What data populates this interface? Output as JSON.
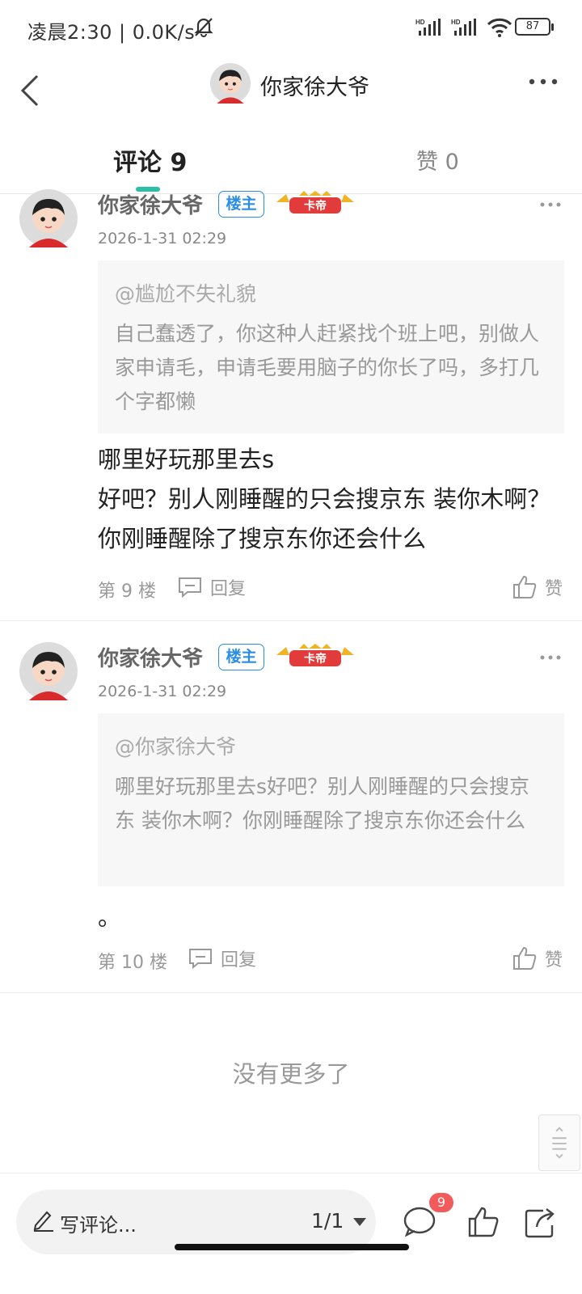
{
  "status_bar": {
    "text": "凌晨2:30 | 0.0K/s",
    "battery": "87"
  },
  "header": {
    "title": "你家徐大爷"
  },
  "tabs": {
    "comments": "评论 9",
    "likes": "赞 0"
  },
  "comments": [
    {
      "author": "你家徐大爷",
      "owner_badge": "楼主",
      "card_badge": "卡帝",
      "time": "2026-1-31 02:29",
      "quote_author": "@尴尬不失礼貌",
      "quote_text": "自己蠢透了，你这种人赶紧找个班上吧，别做人家申请毛，申请毛要用脑子的你长了吗，多打几个字都懒",
      "body": "哪里好玩那里去s\n好吧？别人刚睡醒的只会搜京东 装你木啊？你刚睡醒除了搜京东你还会什么",
      "floor": "第 9 楼",
      "reply": "回复",
      "like": "赞"
    },
    {
      "author": "你家徐大爷",
      "owner_badge": "楼主",
      "card_badge": "卡帝",
      "time": "2026-1-31 02:29",
      "quote_author": "@你家徐大爷",
      "quote_text": "哪里好玩那里去s好吧？别人刚睡醒的只会搜京东 装你木啊？你刚睡醒除了搜京东你还会什么",
      "body": "。",
      "floor": "第 10 楼",
      "reply": "回复",
      "like": "赞"
    }
  ],
  "footer": {
    "no_more": "没有更多了"
  },
  "bottom_bar": {
    "placeholder": "写评论...",
    "page": "1/1",
    "comment_count": "9"
  },
  "colors": {
    "accent": "#2dbfa6",
    "owner_badge": "#2b8de8",
    "badge_red": "#f25b5b"
  }
}
